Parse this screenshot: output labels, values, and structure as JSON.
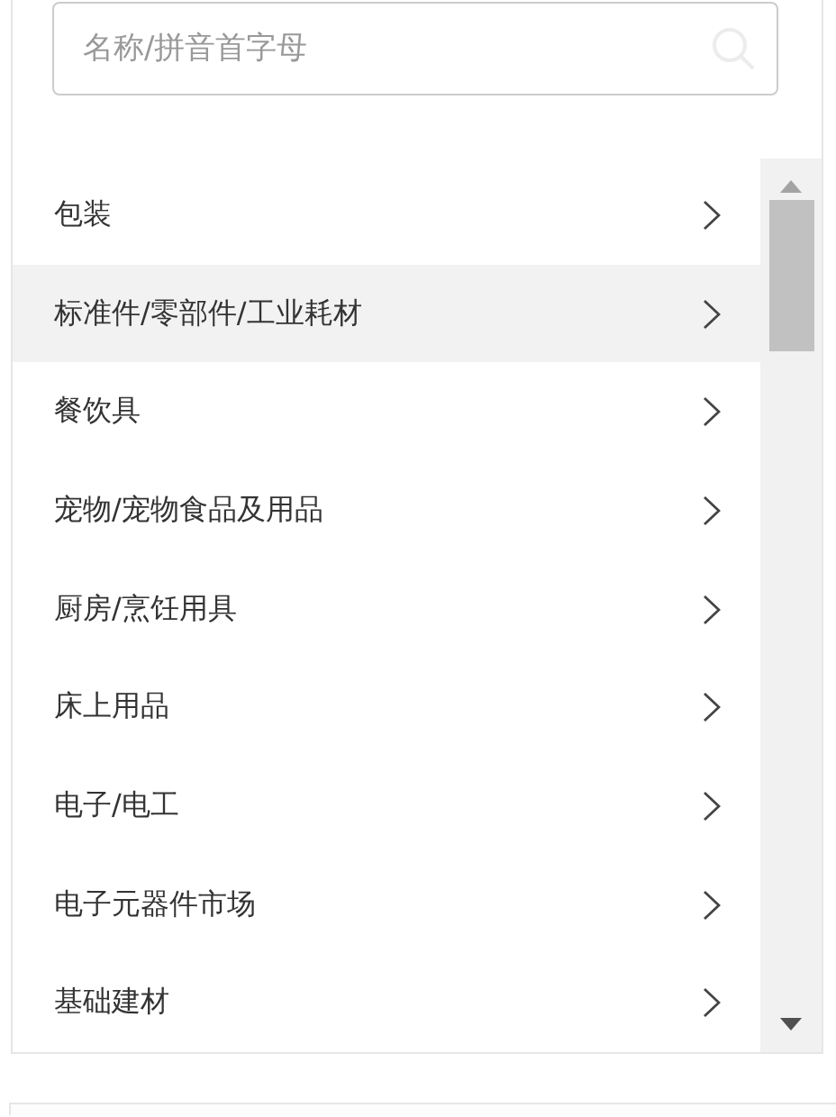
{
  "search": {
    "placeholder": "名称/拼音首字母"
  },
  "categories": [
    {
      "label": "包装",
      "selected": false
    },
    {
      "label": "标准件/零部件/工业耗材",
      "selected": true
    },
    {
      "label": "餐饮具",
      "selected": false
    },
    {
      "label": "宠物/宠物食品及用品",
      "selected": false
    },
    {
      "label": "厨房/烹饪用具",
      "selected": false
    },
    {
      "label": "床上用品",
      "selected": false
    },
    {
      "label": "电子/电工",
      "selected": false
    },
    {
      "label": "电子元器件市场",
      "selected": false
    },
    {
      "label": "基础建材",
      "selected": false
    }
  ]
}
